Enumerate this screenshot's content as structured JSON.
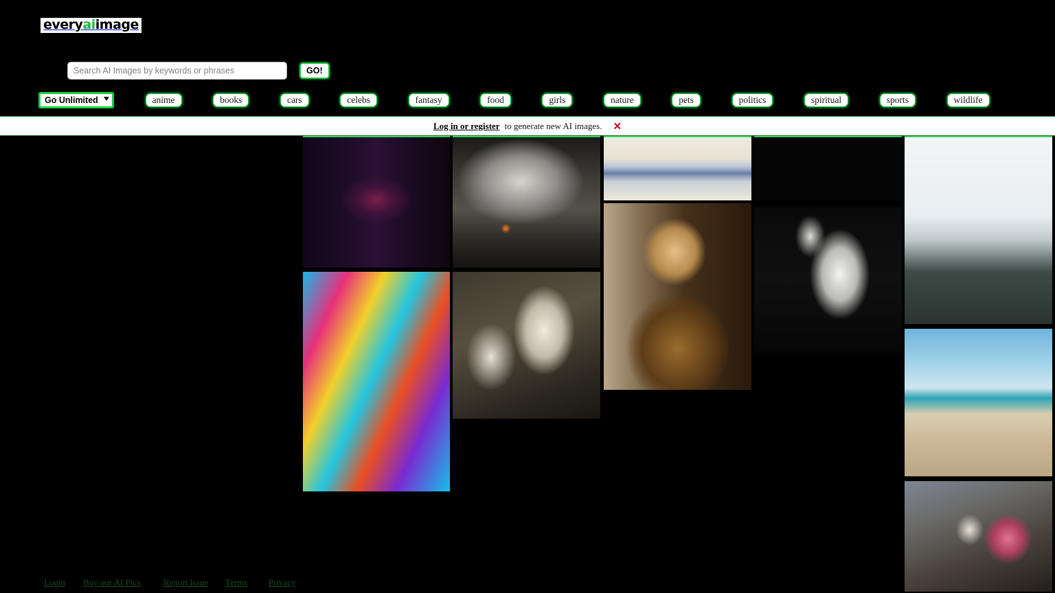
{
  "site": {
    "logo_prefix": "every",
    "logo_accent": "ai",
    "logo_suffix": "image",
    "accent_color": "#18b83c",
    "border_green": "#15c23a",
    "background": "#000000"
  },
  "search": {
    "placeholder": "Search AI Images by keywords or phrases",
    "value": "",
    "go_label": "GO!"
  },
  "nav": {
    "unlimited_label": "Go Unlimited!",
    "unlimited_options": [
      "Go Unlimited!"
    ],
    "categories": [
      {
        "label": "anime"
      },
      {
        "label": "books"
      },
      {
        "label": "cars"
      },
      {
        "label": "celebs"
      },
      {
        "label": "fantasy"
      },
      {
        "label": "food"
      },
      {
        "label": "girls"
      },
      {
        "label": "nature"
      },
      {
        "label": "pets"
      },
      {
        "label": "politics"
      },
      {
        "label": "spiritual"
      },
      {
        "label": "sports"
      },
      {
        "label": "wildlife"
      }
    ]
  },
  "notice": {
    "link_text": "Log in or register",
    "message": "to generate new AI images.",
    "close_icon": "✕"
  },
  "gallery": {
    "tiles": [
      {
        "name": "cyberpunk-neon-hand-eye-city"
      },
      {
        "name": "apocalyptic-cave-survivors"
      },
      {
        "name": "watercolor-chinese-water-village"
      },
      {
        "name": "golden-explosion-sparks"
      },
      {
        "name": "anime-girl-short-dark-hair"
      },
      {
        "name": "cheetah-warrior-portrait"
      },
      {
        "name": "white-goat-head-portrait"
      },
      {
        "name": "neon-graffiti-art-gallery"
      },
      {
        "name": "white-horse-rider-with-spear"
      },
      {
        "name": "french-bulldog-on-beach"
      },
      {
        "name": "baroque-skeleton-with-roses"
      }
    ],
    "strip": [
      {
        "name": "cyberpunk-lightning-street"
      },
      {
        "name": "pink-teal-aurora-sky"
      }
    ]
  },
  "footer": {
    "links": [
      {
        "label": "Login"
      },
      {
        "label": "Buy our AI Pics"
      },
      {
        "label": "Report Issue"
      },
      {
        "label": "Terms"
      },
      {
        "label": "Privacy"
      }
    ]
  }
}
